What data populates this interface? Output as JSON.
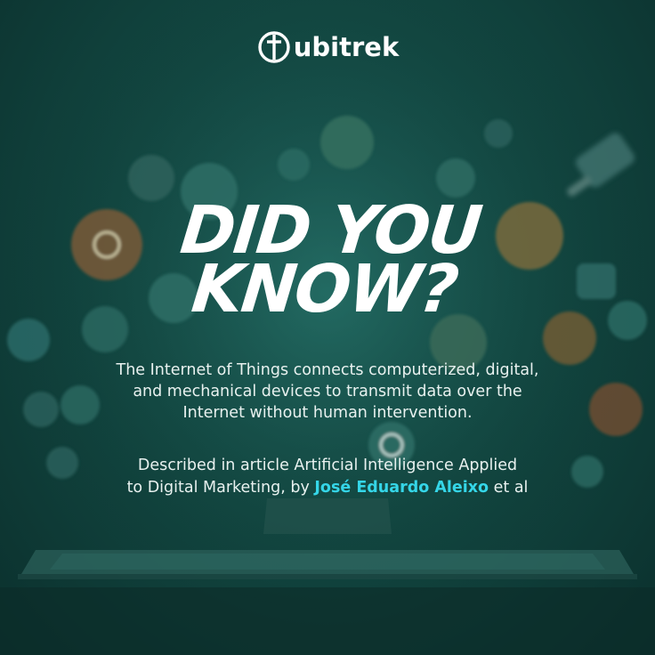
{
  "brand": {
    "name": "ubitrek"
  },
  "headline": {
    "line1": "DID YOU",
    "line2": "KNOW?"
  },
  "body": {
    "line1": "The Internet of Things connects computerized, digital,",
    "line2": "and mechanical devices to transmit data over the",
    "line3": "Internet without human intervention."
  },
  "citation": {
    "line1": "Described in article Artificial Intelligence Applied",
    "line2_prefix": "to Digital Marketing, by",
    "author": "José Eduardo Aleixo",
    "suffix": "et al"
  },
  "colors": {
    "background": "#124741",
    "accent": "#35d6e8",
    "text": "#ffffff"
  }
}
